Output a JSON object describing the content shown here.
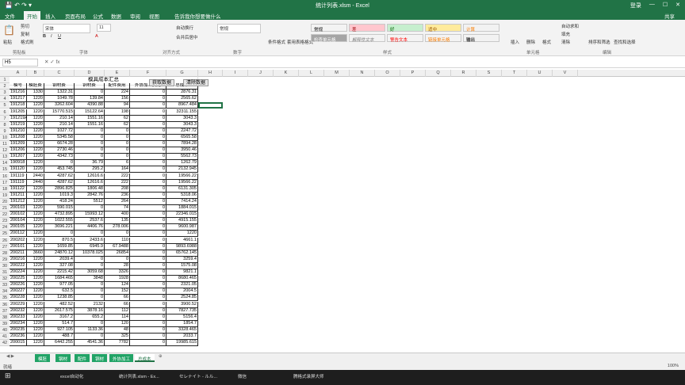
{
  "window": {
    "title": "统计列表.xlsm - Excel",
    "user": "登录",
    "share": "共享"
  },
  "tabs": [
    "文件",
    "开始",
    "插入",
    "页面布局",
    "公式",
    "数据",
    "审阅",
    "视图"
  ],
  "active_tab": "开始",
  "search_tab": "告诉我你想要做什么",
  "ribbon": {
    "clipboard": [
      "粘贴",
      "剪切",
      "复制",
      "格式刷"
    ],
    "font_name": "宋体",
    "font_size": "11",
    "wrap": "自动换行",
    "merge": "合并后居中",
    "number_format": "常规",
    "styles": [
      {
        "label": "常规",
        "color": "#ffffff"
      },
      {
        "label": "差",
        "color": "#ffc7ce"
      },
      {
        "label": "好",
        "color": "#c6efce"
      },
      {
        "label": "适中",
        "color": "#ffeb9c"
      },
      {
        "label": "计算",
        "color": "#f2f2f2"
      },
      {
        "label": "检查单元格",
        "color": "#a5a5a5"
      },
      {
        "label": "解释性文本",
        "color": "#ffffff"
      },
      {
        "label": "警告文本",
        "color": "#ffffff"
      },
      {
        "label": "链接单元格",
        "color": "#ffffff"
      },
      {
        "label": "输出",
        "color": "#f2f2f2"
      }
    ],
    "cond_format": "条件格式",
    "table_format": "套用表格格式",
    "insert": "插入",
    "delete": "删除",
    "format": "格式",
    "autosum": "自动求和",
    "fill": "填充",
    "clear": "清除",
    "sort": "排序和筛选",
    "find": "查找和选择",
    "groups": [
      "剪贴板",
      "字体",
      "对齐方式",
      "数字",
      "样式",
      "单元格",
      "编辑"
    ]
  },
  "namebox": "H5",
  "columns": [
    "A",
    "B",
    "C",
    "D",
    "E",
    "F",
    "G",
    "H",
    "I",
    "J",
    "K",
    "L",
    "M",
    "N",
    "O",
    "P",
    "Q",
    "R",
    "S",
    "T",
    "U",
    "V"
  ],
  "sheet": {
    "title": "模具成本汇总",
    "btn_get": "获取数据",
    "btn_clear": "清除数据",
    "headers": [
      "模号",
      "模胚费",
      "钢材费",
      "铜材费",
      "配件费用",
      "外协加工费用",
      "总成本"
    ],
    "rows": [
      [
        "191216",
        "1330",
        "1322.31",
        "0",
        "224",
        "0",
        "2876.31"
      ],
      [
        "191217",
        "1220",
        "1049.78",
        "139.84",
        "156",
        "0",
        "2565.62"
      ],
      [
        "191218",
        "1220",
        "3262.604",
        "4390.88",
        "94",
        "0",
        "8967.484"
      ],
      [
        "191205",
        "1220",
        "15770.515",
        "15122.64",
        "198",
        "0",
        "32311.155"
      ],
      [
        "191219A",
        "1220",
        "210.14",
        "1551.16",
        "62",
        "0",
        "3043.3"
      ],
      [
        "191219",
        "1220",
        "210.14",
        "1551.16",
        "62",
        "0",
        "3043.3"
      ],
      [
        "191210",
        "1220",
        "1027.72",
        "0",
        "0",
        "0",
        "2247.72"
      ],
      [
        "191208",
        "1220",
        "5345.58",
        "0",
        "0",
        "0",
        "6565.58"
      ],
      [
        "191209",
        "1220",
        "6674.28",
        "0",
        "0",
        "0",
        "7894.28"
      ],
      [
        "191206",
        "1220",
        "2730.46",
        "0",
        "0",
        "0",
        "3950.46"
      ],
      [
        "191207",
        "1220",
        "4342.73",
        "0",
        "0",
        "0",
        "5562.73"
      ],
      [
        "190918",
        "1220",
        "0",
        "36.79",
        "6",
        "0",
        "1262.79"
      ],
      [
        "191120",
        "1220",
        "453.745",
        "295.2",
        "164",
        "0",
        "2132.945"
      ],
      [
        "191119",
        "2440",
        "4287.62",
        "12616.6",
        "222",
        "0",
        "19566.22"
      ],
      [
        "191119",
        "2440",
        "4287.62",
        "12616.6",
        "222",
        "0",
        "19566.22"
      ],
      [
        "191122",
        "1220",
        "2896.825",
        "1806.48",
        "208",
        "0",
        "6131.305"
      ],
      [
        "191211",
        "1220",
        "1019.3",
        "2842.76",
        "236",
        "0",
        "5318.06"
      ],
      [
        "191212",
        "1220",
        "418.24",
        "5512",
        "264",
        "0",
        "7414.24"
      ],
      [
        "200103",
        "1220",
        "590.015",
        "0",
        "74",
        "0",
        "1884.015"
      ],
      [
        "200102",
        "1220",
        "4732.895",
        "15993.12",
        "400",
        "0",
        "22346.015"
      ],
      [
        "200104",
        "1220",
        "1022.555",
        "2537.6",
        "135",
        "0",
        "4915.155"
      ],
      [
        "200105",
        "1220",
        "3696.221",
        "4406.76",
        "278.006",
        "0",
        "9600.987"
      ],
      [
        "200112",
        "1220",
        "0",
        "0",
        "0",
        "0",
        "1220"
      ],
      [
        "200202",
        "1220",
        "870.5",
        "2433.6",
        "110",
        "0",
        "4661.1"
      ],
      [
        "200101",
        "1220",
        "1659.85",
        "6945.9",
        "67.9488",
        "0",
        "9893.6988"
      ],
      [
        "200211",
        "3660",
        "24870.12",
        "10378.025",
        "26854",
        "0",
        "65762.145"
      ],
      [
        "200216",
        "1220",
        "2039.4",
        "0",
        "0",
        "0",
        "3259.4"
      ],
      [
        "200222",
        "1220",
        "327.08",
        "0",
        "28",
        "0",
        "1575.08"
      ],
      [
        "200224",
        "1220",
        "2215.42",
        "3059.68",
        "3326",
        "0",
        "9821.1"
      ],
      [
        "200225",
        "1220",
        "1684.465",
        "3848",
        "1928",
        "0",
        "8680.465"
      ],
      [
        "200226",
        "1220",
        "977.05",
        "0",
        "124",
        "0",
        "2321.05"
      ],
      [
        "200227",
        "1220",
        "632.5",
        "0",
        "152",
        "0",
        "2004.5"
      ],
      [
        "200228",
        "1220",
        "1238.85",
        "0",
        "66",
        "0",
        "2524.85"
      ],
      [
        "200229",
        "1220",
        "482.52",
        "2132",
        "66",
        "0",
        "3900.52"
      ],
      [
        "200232",
        "1220",
        "2617.575",
        "3878.16",
        "112",
        "0",
        "7827.735"
      ],
      [
        "200233",
        "1220",
        "3167.2",
        "655.2",
        "114",
        "0",
        "5156.4"
      ],
      [
        "200234",
        "1220",
        "514.7",
        "0",
        "120",
        "0",
        "1854.7"
      ],
      [
        "200235",
        "1220",
        "927.105",
        "1133.36",
        "48",
        "0",
        "3328.465"
      ],
      [
        "200236",
        "1220",
        "488.7",
        "0",
        "325",
        "0",
        "2033.7"
      ],
      [
        "200015",
        "1220",
        "6442.255",
        "4541.36",
        "7782",
        "0",
        "19985.615"
      ]
    ]
  },
  "sheet_tabs": [
    "模胚",
    "钢材",
    "配件",
    "铜材",
    "外协加工",
    "总成本"
  ],
  "active_sheet": "总成本",
  "status": "就绪",
  "zoom": "100%",
  "taskbar": [
    "excel自动化",
    "统计列表.xlsm - Ex...",
    "セレナイト - ルル...",
    "微信",
    "腾格式录屏大师"
  ]
}
